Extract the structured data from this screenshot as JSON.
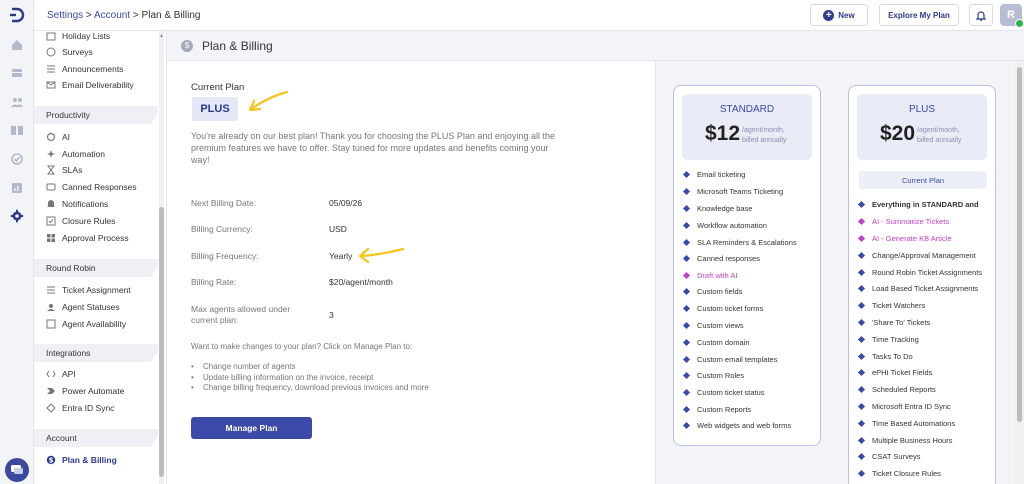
{
  "breadcrumb": {
    "settings": "Settings",
    "sep1": ">",
    "account": "Account",
    "sep2": ">",
    "current": "Plan & Billing"
  },
  "topbar": {
    "new_label": "New",
    "explore_label": "Explore My Plan",
    "avatar_initial": "R"
  },
  "sidebar": {
    "top_items": [
      "Holiday Lists",
      "Surveys",
      "Announcements",
      "Email Deliverability"
    ],
    "productivity": {
      "title": "Productivity",
      "items": [
        "AI",
        "Automation",
        "SLAs",
        "Canned Responses",
        "Notifications",
        "Closure Rules",
        "Approval Process"
      ]
    },
    "round_robin": {
      "title": "Round Robin",
      "items": [
        "Ticket Assignment",
        "Agent Statuses",
        "Agent Availability"
      ]
    },
    "integrations": {
      "title": "Integrations",
      "items": [
        "API",
        "Power Automate",
        "Entra ID Sync"
      ]
    },
    "account": {
      "title": "Account",
      "items": [
        "Plan & Billing"
      ]
    }
  },
  "page": {
    "title": "Plan & Billing"
  },
  "current_plan": {
    "label": "Current Plan",
    "plan": "PLUS",
    "description": "You're already on our best plan! Thank you for choosing the PLUS Plan and enjoying all the premium features we have to offer. Stay tuned for more updates and benefits coming your way!"
  },
  "billing": {
    "next_date_label": "Next Billing Date:",
    "next_date": "05/09/26",
    "currency_label": "Billing Currency:",
    "currency": "USD",
    "frequency_label": "Billing Frequency:",
    "frequency": "Yearly",
    "rate_label": "Billing Rate:",
    "rate": "$20/agent/month",
    "max_agents_label_1": "Max agents allowed under",
    "max_agents_label_2": "current plan:",
    "max_agents": "3"
  },
  "manage": {
    "intro": "Want to make changes to your plan? Click on Manage Plan to:",
    "items": [
      "Change number of agents",
      "Update billing information on the invoice, receipt",
      "Change billing frequency, download previous invoices and more"
    ],
    "button": "Manage Plan"
  },
  "plans": {
    "standard": {
      "name": "STANDARD",
      "price": "$12",
      "per_1": "/agent/month,",
      "per_2": "billed annually",
      "features": [
        "Email ticketing",
        "Microsoft Teams Ticketing",
        "Knowledge base",
        "Workflow automation",
        "SLA Reminders & Escalations",
        "Canned responses",
        "Draft with AI",
        "Custom fields",
        "Custom ticket forms",
        "Custom views",
        "Custom domain",
        "Custom email templates",
        "Custom Roles",
        "Custom ticket status",
        "Custom Reports",
        "Web widgets and web forms"
      ]
    },
    "plus": {
      "name": "PLUS",
      "price": "$20",
      "per_1": "/agent/month,",
      "per_2": "billed annually",
      "current_label": "Current Plan",
      "features": [
        "Everything in STANDARD and",
        "AI - Summarize Tickets",
        "AI - Generate KB Article",
        "Change/Approval Management",
        "Round Robin Ticket Assignments",
        "Load Based Ticket Assignments",
        "Ticket Watchers",
        "'Share To' Tickets",
        "Time Tracking",
        "Tasks To Do",
        "ePHI Ticket Fields",
        "Scheduled Reports",
        "Microsoft Entra ID Sync",
        "Time Based Automations",
        "Multiple Business Hours",
        "CSAT Surveys",
        "Ticket Closure Rules"
      ]
    }
  },
  "colors": {
    "accent": "#3b4aa8",
    "ai": "#c43fc9",
    "annotation": "#f5c518"
  }
}
